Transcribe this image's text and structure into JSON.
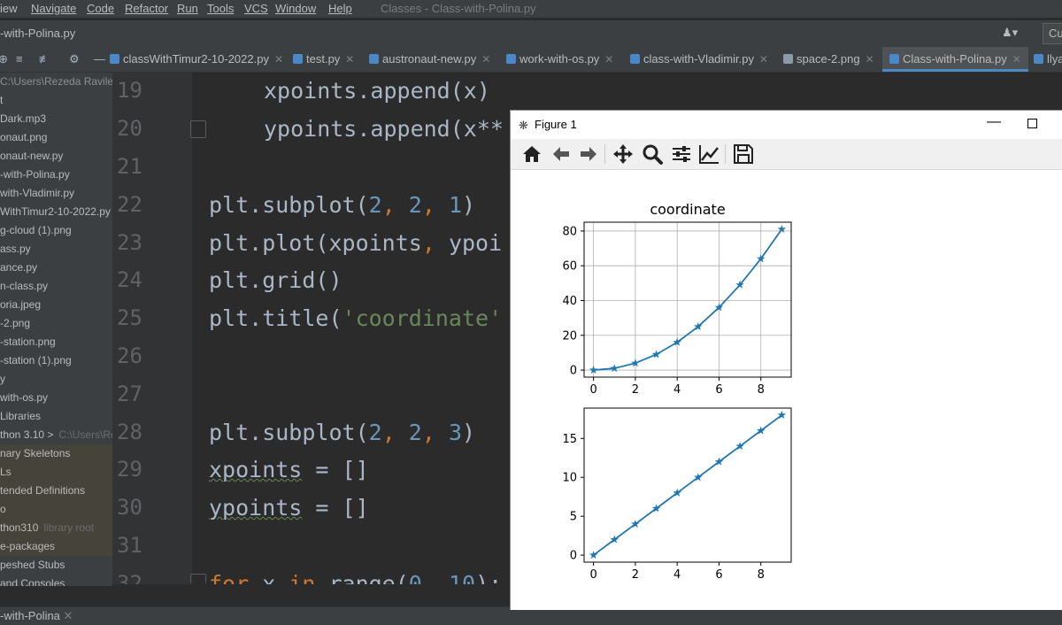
{
  "menubar": {
    "items": [
      "iew",
      "Navigate",
      "Code",
      "Refactor",
      "Run",
      "Tools",
      "VCS",
      "Window",
      "Help"
    ],
    "window_title": "Classes - Class-with-Polina.py"
  },
  "navbar": {
    "crumb": "-with-Polina.py",
    "user_icon": "user-icon",
    "config_button": "Cu"
  },
  "tabs": [
    {
      "label": "classWithTimur2-10-2022.py"
    },
    {
      "label": "test.py"
    },
    {
      "label": "austronaut-new.py"
    },
    {
      "label": "work-with-os.py"
    },
    {
      "label": "class-with-Vladimir.py"
    },
    {
      "label": "space-2.png"
    },
    {
      "label": "Class-with-Polina.py",
      "active": true
    },
    {
      "label": "llya"
    }
  ],
  "sidebar": {
    "path_row": {
      "label": "C:\\Users\\Rezeda Ravilev"
    },
    "items": [
      "t",
      "Dark.mp3",
      "onaut.png",
      "onaut-new.py",
      "-with-Polina.py",
      "with-Vladimir.py",
      "WithTimur2-10-2022.py",
      "g-cloud (1).png",
      "ass.py",
      "ance.py",
      "n-class.py",
      "oria.jpeg",
      "-2.png",
      "-station.png",
      "-station (1).png",
      "y",
      "with-os.py",
      "Libraries"
    ],
    "python_row": {
      "label": "thon 3.10 >",
      "dim": "C:\\Users\\Rez"
    },
    "lib_items": [
      {
        "label": "nary Skeletons"
      },
      {
        "label": "Ls"
      },
      {
        "label": "tended Definitions"
      },
      {
        "label": "o"
      },
      {
        "label": "thon310",
        "dim": "library root"
      },
      {
        "label": "e-packages"
      }
    ],
    "tail_items": [
      "peshed Stubs",
      " and Consoles"
    ]
  },
  "editor": {
    "line_numbers": [
      "19",
      "20",
      "21",
      "22",
      "23",
      "24",
      "25",
      "26",
      "27",
      "28",
      "29",
      "30",
      "31",
      "32"
    ],
    "lines": {
      "l19": "xpoints.append(x)",
      "l20": "ypoints.append(x**",
      "l22a": "plt.subplot(",
      "l22b": "2",
      "l22c": ", ",
      "l22d": "2",
      "l22e": ", ",
      "l22f": "1",
      "l22g": ")",
      "l23a": "plt.plot(xpoints",
      "l23b": ", ",
      "l23c": "ypoi",
      "l24": "plt.grid()",
      "l25a": "plt.title(",
      "l25b": "'coordinate'",
      "l28a": "plt.subplot(",
      "l28b": "2",
      "l28c": ", ",
      "l28d": "2",
      "l28e": ", ",
      "l28f": "3",
      "l28g": ")",
      "l29a": "xpoints",
      "l29b": " = []",
      "l30a": "ypoints",
      "l30b": " = []",
      "l32a": "for",
      "l32b": " x ",
      "l32c": "in",
      "l32d": " range(",
      "l32e": "0",
      "l32f": ", ",
      "l32g": "10",
      "l32h": "):"
    }
  },
  "bottombar": {
    "tab_label": "-with-Polina"
  },
  "figure": {
    "title": "Figure 1",
    "toolbar_icons": [
      "home-icon",
      "back-icon",
      "forward-icon",
      "pan-icon",
      "zoom-icon",
      "configure-subplots-icon",
      "edit-axis-icon",
      "save-icon"
    ]
  },
  "chart_data": [
    {
      "type": "line",
      "title": "coordinate",
      "marker": "*",
      "grid": true,
      "x": [
        0,
        1,
        2,
        3,
        4,
        5,
        6,
        7,
        8,
        9
      ],
      "y": [
        0,
        1,
        4,
        9,
        16,
        25,
        36,
        49,
        64,
        81
      ],
      "xticks": [
        "0",
        "2",
        "4",
        "6",
        "8"
      ],
      "yticks": [
        "0",
        "20",
        "40",
        "60",
        "80"
      ],
      "xlim": [
        -0.45,
        9.45
      ],
      "ylim": [
        -4.05,
        85.05
      ],
      "color": "#1f77b4"
    },
    {
      "type": "line",
      "title": "",
      "marker": "*",
      "grid": false,
      "x": [
        0,
        1,
        2,
        3,
        4,
        5,
        6,
        7,
        8,
        9
      ],
      "y": [
        0,
        2,
        4,
        6,
        8,
        10,
        12,
        14,
        16,
        18
      ],
      "xticks": [
        "0",
        "2",
        "4",
        "6",
        "8"
      ],
      "yticks": [
        "0",
        "5",
        "10",
        "15"
      ],
      "xlim": [
        -0.45,
        9.45
      ],
      "ylim": [
        -0.9,
        18.9
      ],
      "color": "#1f77b4"
    }
  ]
}
